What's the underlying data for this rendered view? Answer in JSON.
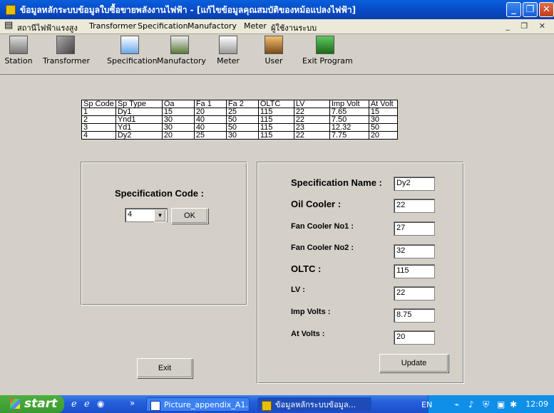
{
  "window": {
    "title": "ข้อมูลหลักระบบข้อมูลใบซื้อขายพลังงานไฟฟ้า - [แก้ไขข้อมูลคุณสมบัติของหม้อแปลงไฟฟ้า]"
  },
  "menu": [
    "สถานีไฟฟ้าแรงสูง",
    "Transformer",
    "Specification",
    "Manufactory",
    "Meter",
    "ผู้ใช้งานระบบ"
  ],
  "toolbar": [
    "Station",
    "Transformer",
    "Specification",
    "Manufactory",
    "Meter",
    "User",
    "Exit Program"
  ],
  "grid": {
    "headers": [
      "Sp Code",
      "Sp Type",
      "Oa",
      "Fa 1",
      "Fa 2",
      "OLTC",
      "LV",
      "Imp Volt",
      "At Volt"
    ],
    "rows": [
      [
        "1",
        "Dy1",
        "15",
        "20",
        "25",
        "115",
        "22",
        "7.65",
        "15"
      ],
      [
        "2",
        "Ynd1",
        "30",
        "40",
        "50",
        "115",
        "22",
        "7.50",
        "30"
      ],
      [
        "3",
        "Yd1",
        "30",
        "40",
        "50",
        "115",
        "23",
        "12.32",
        "50"
      ],
      [
        "4",
        "Dy2",
        "20",
        "25",
        "30",
        "115",
        "22",
        "7.75",
        "20"
      ]
    ]
  },
  "left_panel": {
    "label": "Specification Code :",
    "code_value": "4",
    "ok_label": "OK",
    "exit_label": "Exit"
  },
  "right_panel": {
    "spec_name_label": "Specification Name :",
    "spec_name_value": "Dy2",
    "oil_cooler_label": "Oil Cooler :",
    "oil_cooler_value": "22",
    "fan1_label": "Fan Cooler No1 :",
    "fan1_value": "27",
    "fan2_label": "Fan Cooler No2 :",
    "fan2_value": "32",
    "oltc_label": "OLTC :",
    "oltc_value": "115",
    "lv_label": "LV :",
    "lv_value": "22",
    "imp_label": "Imp Volts :",
    "imp_value": "8.75",
    "at_label": "At Volts :",
    "at_value": "20",
    "update_label": "Update"
  },
  "taskbar": {
    "start": "start",
    "task1": "Picture_appendix_A1...",
    "task2": "ข้อมูลหลักระบบข้อมูล...",
    "lang": "EN",
    "clock": "12:09"
  }
}
